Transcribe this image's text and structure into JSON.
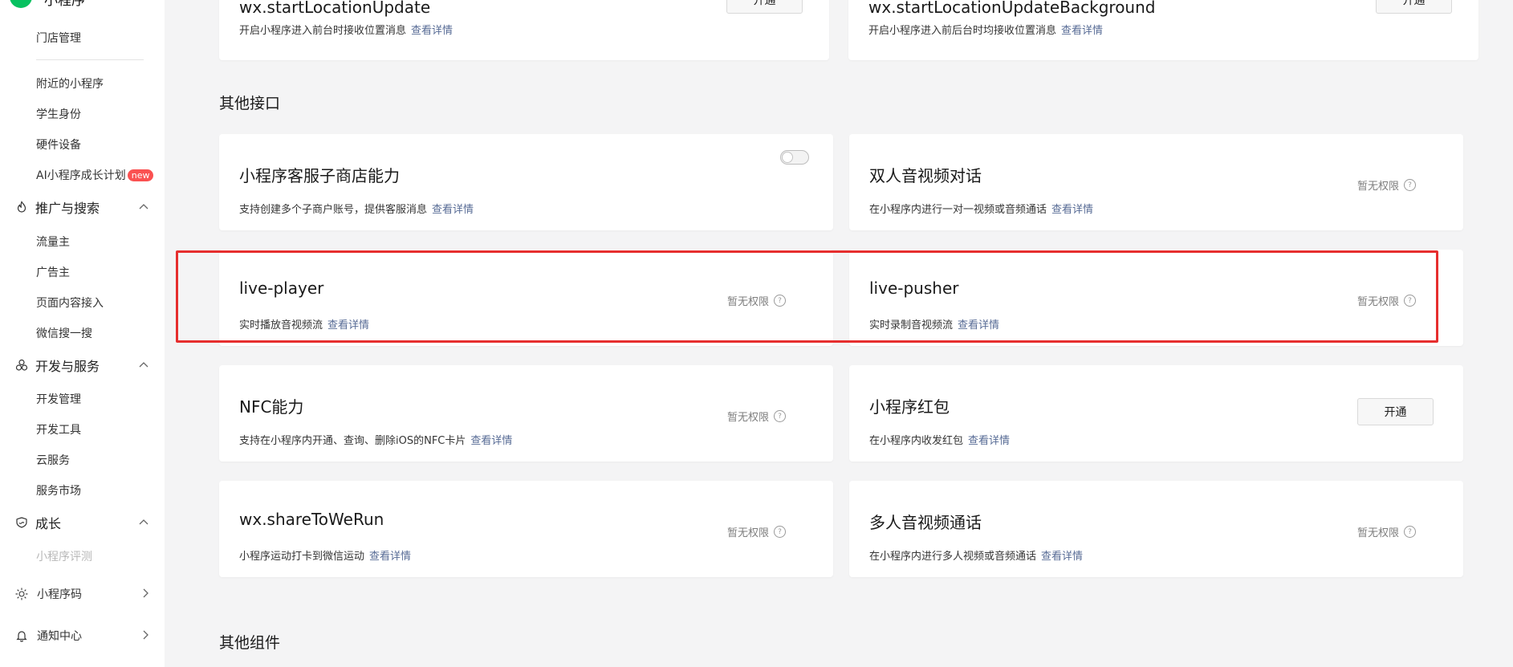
{
  "sidebar": {
    "logo_text": "小程序",
    "item_store": "门店管理",
    "items_top": [
      {
        "label": "附近的小程序"
      },
      {
        "label": "学生身份"
      },
      {
        "label": "硬件设备"
      },
      {
        "label": "AI小程序成长计划",
        "badge": "new"
      }
    ],
    "group_promo": {
      "label": "推广与搜索",
      "icon": "flame-icon"
    },
    "items_promo": [
      {
        "label": "流量主"
      },
      {
        "label": "广告主"
      },
      {
        "label": "页面内容接入"
      },
      {
        "label": "微信搜一搜"
      }
    ],
    "group_dev": {
      "label": "开发与服务",
      "icon": "dev-services-icon"
    },
    "items_dev": [
      {
        "label": "开发管理"
      },
      {
        "label": "开发工具"
      },
      {
        "label": "云服务"
      },
      {
        "label": "服务市场"
      }
    ],
    "group_growth": {
      "label": "成长",
      "icon": "growth-icon"
    },
    "item_growth_faded": "小程序评测",
    "item_qrcode": {
      "label": "小程序码",
      "icon": "qrcode-sun-icon"
    },
    "item_notify": {
      "label": "通知中心",
      "icon": "bell-icon"
    }
  },
  "main": {
    "top_cards": [
      {
        "title": "wx.startLocationUpdate",
        "desc": "开启小程序进入前台时接收位置消息",
        "link": "查看详情",
        "button": "开通"
      },
      {
        "title": "wx.startLocationUpdateBackground",
        "desc": "开启小程序进入前后台时均接收位置消息",
        "link": "查看详情",
        "button": "开通"
      }
    ],
    "section_other_api": "其他接口",
    "cards": [
      {
        "title": "小程序客服子商店能力",
        "desc": "支持创建多个子商户账号，提供客服消息",
        "link": "查看详情",
        "status": "toggle-off"
      },
      {
        "title": "双人音视频对话",
        "desc": "在小程序内进行一对一视频或音频通话",
        "link": "查看详情",
        "status": "暂无权限"
      },
      {
        "title": "live-player",
        "desc": "实时播放音视频流",
        "link": "查看详情",
        "status": "暂无权限"
      },
      {
        "title": "live-pusher",
        "desc": "实时录制音视频流",
        "link": "查看详情",
        "status": "暂无权限"
      },
      {
        "title": "NFC能力",
        "desc": "支持在小程序内开通、查询、删除iOS的NFC卡片",
        "link": "查看详情",
        "status": "暂无权限"
      },
      {
        "title": "小程序红包",
        "desc": "在小程序内收发红包",
        "link": "查看详情",
        "button": "开通"
      },
      {
        "title": "wx.shareToWeRun",
        "desc": "小程序运动打卡到微信运动",
        "link": "查看详情",
        "status": "暂无权限"
      },
      {
        "title": "多人音视频通话",
        "desc": "在小程序内进行多人视频或音频通话",
        "link": "查看详情",
        "status": "暂无权限"
      }
    ],
    "section_other_components": "其他组件"
  },
  "colors": {
    "accent_green": "#07c160",
    "link": "#576b95",
    "highlight_red": "#e62e2e",
    "badge_red": "#fa5151",
    "background": "#f4f4f5"
  }
}
